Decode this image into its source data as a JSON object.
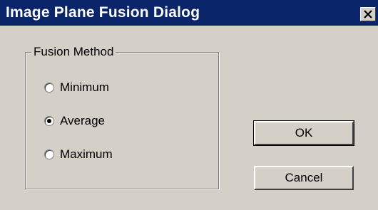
{
  "window": {
    "title": "Image Plane Fusion Dialog",
    "close_icon": "close-icon"
  },
  "fusion_method": {
    "group_label": "Fusion Method",
    "options": [
      {
        "label": "Minimum",
        "selected": false
      },
      {
        "label": "Average",
        "selected": true
      },
      {
        "label": "Maximum",
        "selected": false
      }
    ]
  },
  "buttons": {
    "ok_label": "OK",
    "cancel_label": "Cancel"
  },
  "colors": {
    "title_bar": "#0a246a",
    "dialog_face": "#d4d0c8"
  }
}
